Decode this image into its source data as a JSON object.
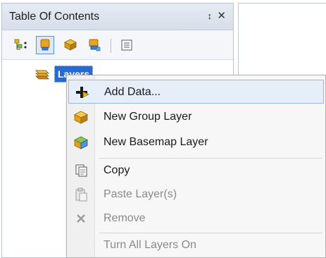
{
  "toc": {
    "title": "Table Of Contents",
    "pin_glyph": "↕",
    "close_glyph": "✕",
    "toolbar": [
      {
        "icon": "list-by-drawing-order-icon",
        "active": false
      },
      {
        "icon": "list-by-source-icon",
        "active": true
      },
      {
        "icon": "list-by-visibility-icon",
        "active": false
      },
      {
        "icon": "list-by-selection-icon",
        "active": false
      },
      {
        "icon": "options-icon",
        "active": false
      }
    ],
    "tree": {
      "root_label": "Layers",
      "root_icon": "layers-stack-icon"
    }
  },
  "context_menu": {
    "items": [
      {
        "label": "Add Data...",
        "icon": "add-data-icon",
        "enabled": true,
        "hover": true
      },
      {
        "label": "New Group Layer",
        "icon": "group-layer-icon",
        "enabled": true
      },
      {
        "label": "New Basemap Layer",
        "icon": "basemap-layer-icon",
        "enabled": true
      },
      {
        "label": "Copy",
        "icon": "copy-icon",
        "enabled": true
      },
      {
        "label": "Paste Layer(s)",
        "icon": "paste-icon",
        "enabled": false
      },
      {
        "label": "Remove",
        "icon": "remove-icon",
        "enabled": false
      },
      {
        "label": "Turn All Layers On",
        "icon": "",
        "enabled": false
      }
    ]
  },
  "colors": {
    "selection_blue": "#2a6ad0",
    "menu_hover": "#e6eefa",
    "disabled_text": "#8a8a8a"
  }
}
